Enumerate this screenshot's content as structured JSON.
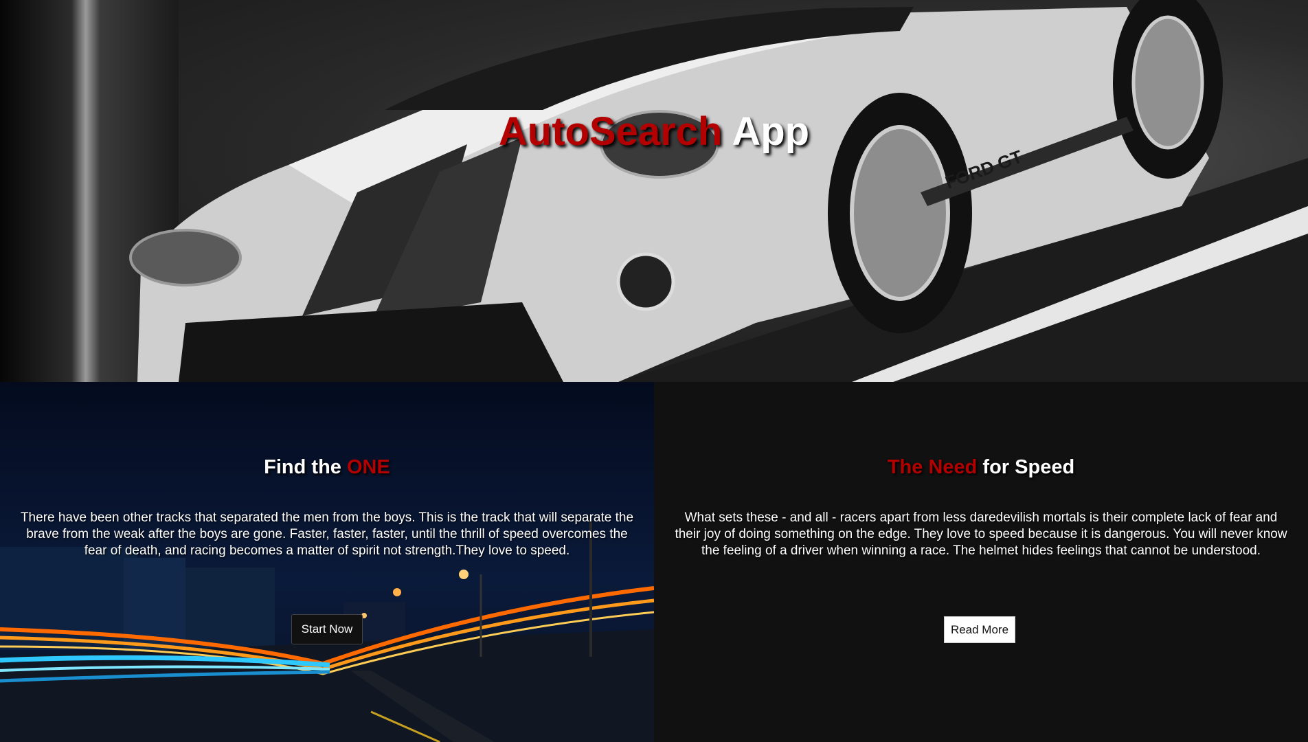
{
  "hero": {
    "title_accent": "AutoSearch",
    "title_plain": " App",
    "badge_text": "FORD GT"
  },
  "left_panel": {
    "heading_plain": "Find the ",
    "heading_accent": "ONE",
    "text": "There have been other tracks that separated the men from the boys. This is the track that will separate the brave from the weak after the boys are gone. Faster, faster, faster, until the thrill of speed overcomes the fear of death, and racing becomes a matter of spirit not strength.They love to speed.",
    "button_label": "Start Now"
  },
  "right_panel": {
    "heading_accent": "The Need",
    "heading_plain": " for Speed",
    "text": "What sets these - and all - racers apart from less daredevilish mortals is their complete lack of fear and their joy of doing something on the edge. They love to speed because it is dangerous. You will never know the feeling of a driver when winning a race. The helmet hides feelings that cannot be understood.",
    "button_label": "Read More"
  },
  "colors": {
    "accent": "#b30000",
    "left_bg": "#061026",
    "right_bg": "#111111"
  }
}
